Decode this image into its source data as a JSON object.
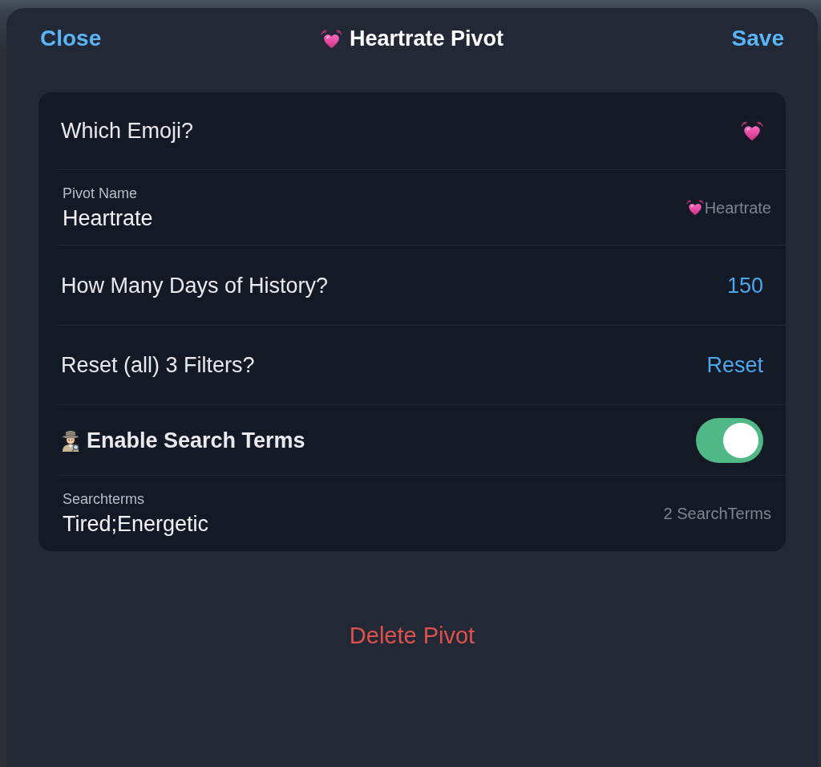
{
  "header": {
    "close": "Close",
    "title": "Heartrate Pivot",
    "save": "Save"
  },
  "rows": [
    {
      "kind": "emoji",
      "label": "Which Emoji?"
    },
    {
      "kind": "name-field",
      "label": "Pivot Name",
      "value": "Heartrate",
      "note": "Heartrate"
    },
    {
      "kind": "value",
      "label": "How Many Days of History?",
      "value": "150"
    },
    {
      "kind": "action",
      "label": "Reset (all) 3 Filters?",
      "action": "Reset"
    },
    {
      "kind": "toggle",
      "label": "Enable Search Terms",
      "on": true
    },
    {
      "kind": "text-field",
      "label": "Searchterms",
      "value": "Tired;Energetic",
      "note": "2 SearchTerms"
    }
  ],
  "delete": "Delete Pivot"
}
